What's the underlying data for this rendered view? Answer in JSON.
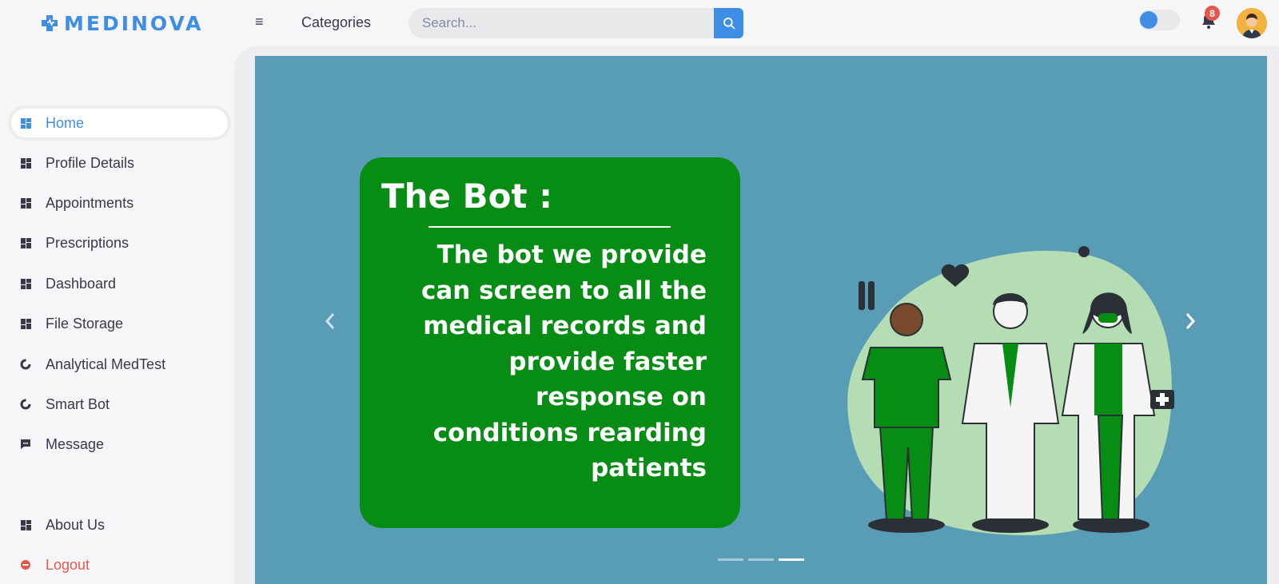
{
  "brand": {
    "name": "MEDINOVA",
    "color": "#3f8ee6"
  },
  "header": {
    "menu_icon": "hamburger-icon",
    "categories_label": "Categories",
    "search": {
      "placeholder": "Search...",
      "value": ""
    },
    "notifications": {
      "count": "8"
    }
  },
  "sidebar": {
    "items": [
      {
        "label": "Home",
        "icon": "grid-icon",
        "active": true
      },
      {
        "label": "Profile Details",
        "icon": "grid-icon"
      },
      {
        "label": "Appointments",
        "icon": "grid-icon"
      },
      {
        "label": "Prescriptions",
        "icon": "grid-icon"
      },
      {
        "label": "Dashboard",
        "icon": "grid-icon"
      },
      {
        "label": "File Storage",
        "icon": "grid-icon"
      },
      {
        "label": "Analytical MedTest",
        "icon": "donut-chart-icon"
      },
      {
        "label": "Smart Bot",
        "icon": "donut-chart-icon"
      },
      {
        "label": "Message",
        "icon": "chat-icon"
      },
      {
        "label": "About Us",
        "icon": "grid-icon"
      },
      {
        "label": "Logout",
        "icon": "logout-icon"
      }
    ]
  },
  "carousel": {
    "slide": {
      "title": "The Bot :",
      "body": "The bot we provide can screen to all the medical records and provide faster response on conditions rearding patients"
    },
    "active_indicator": 3,
    "indicator_count": 3
  },
  "colors": {
    "accent": "#3f8ee6",
    "slide_bg": "#589cb6",
    "card_green": "#078c14",
    "danger": "#e4584b"
  }
}
